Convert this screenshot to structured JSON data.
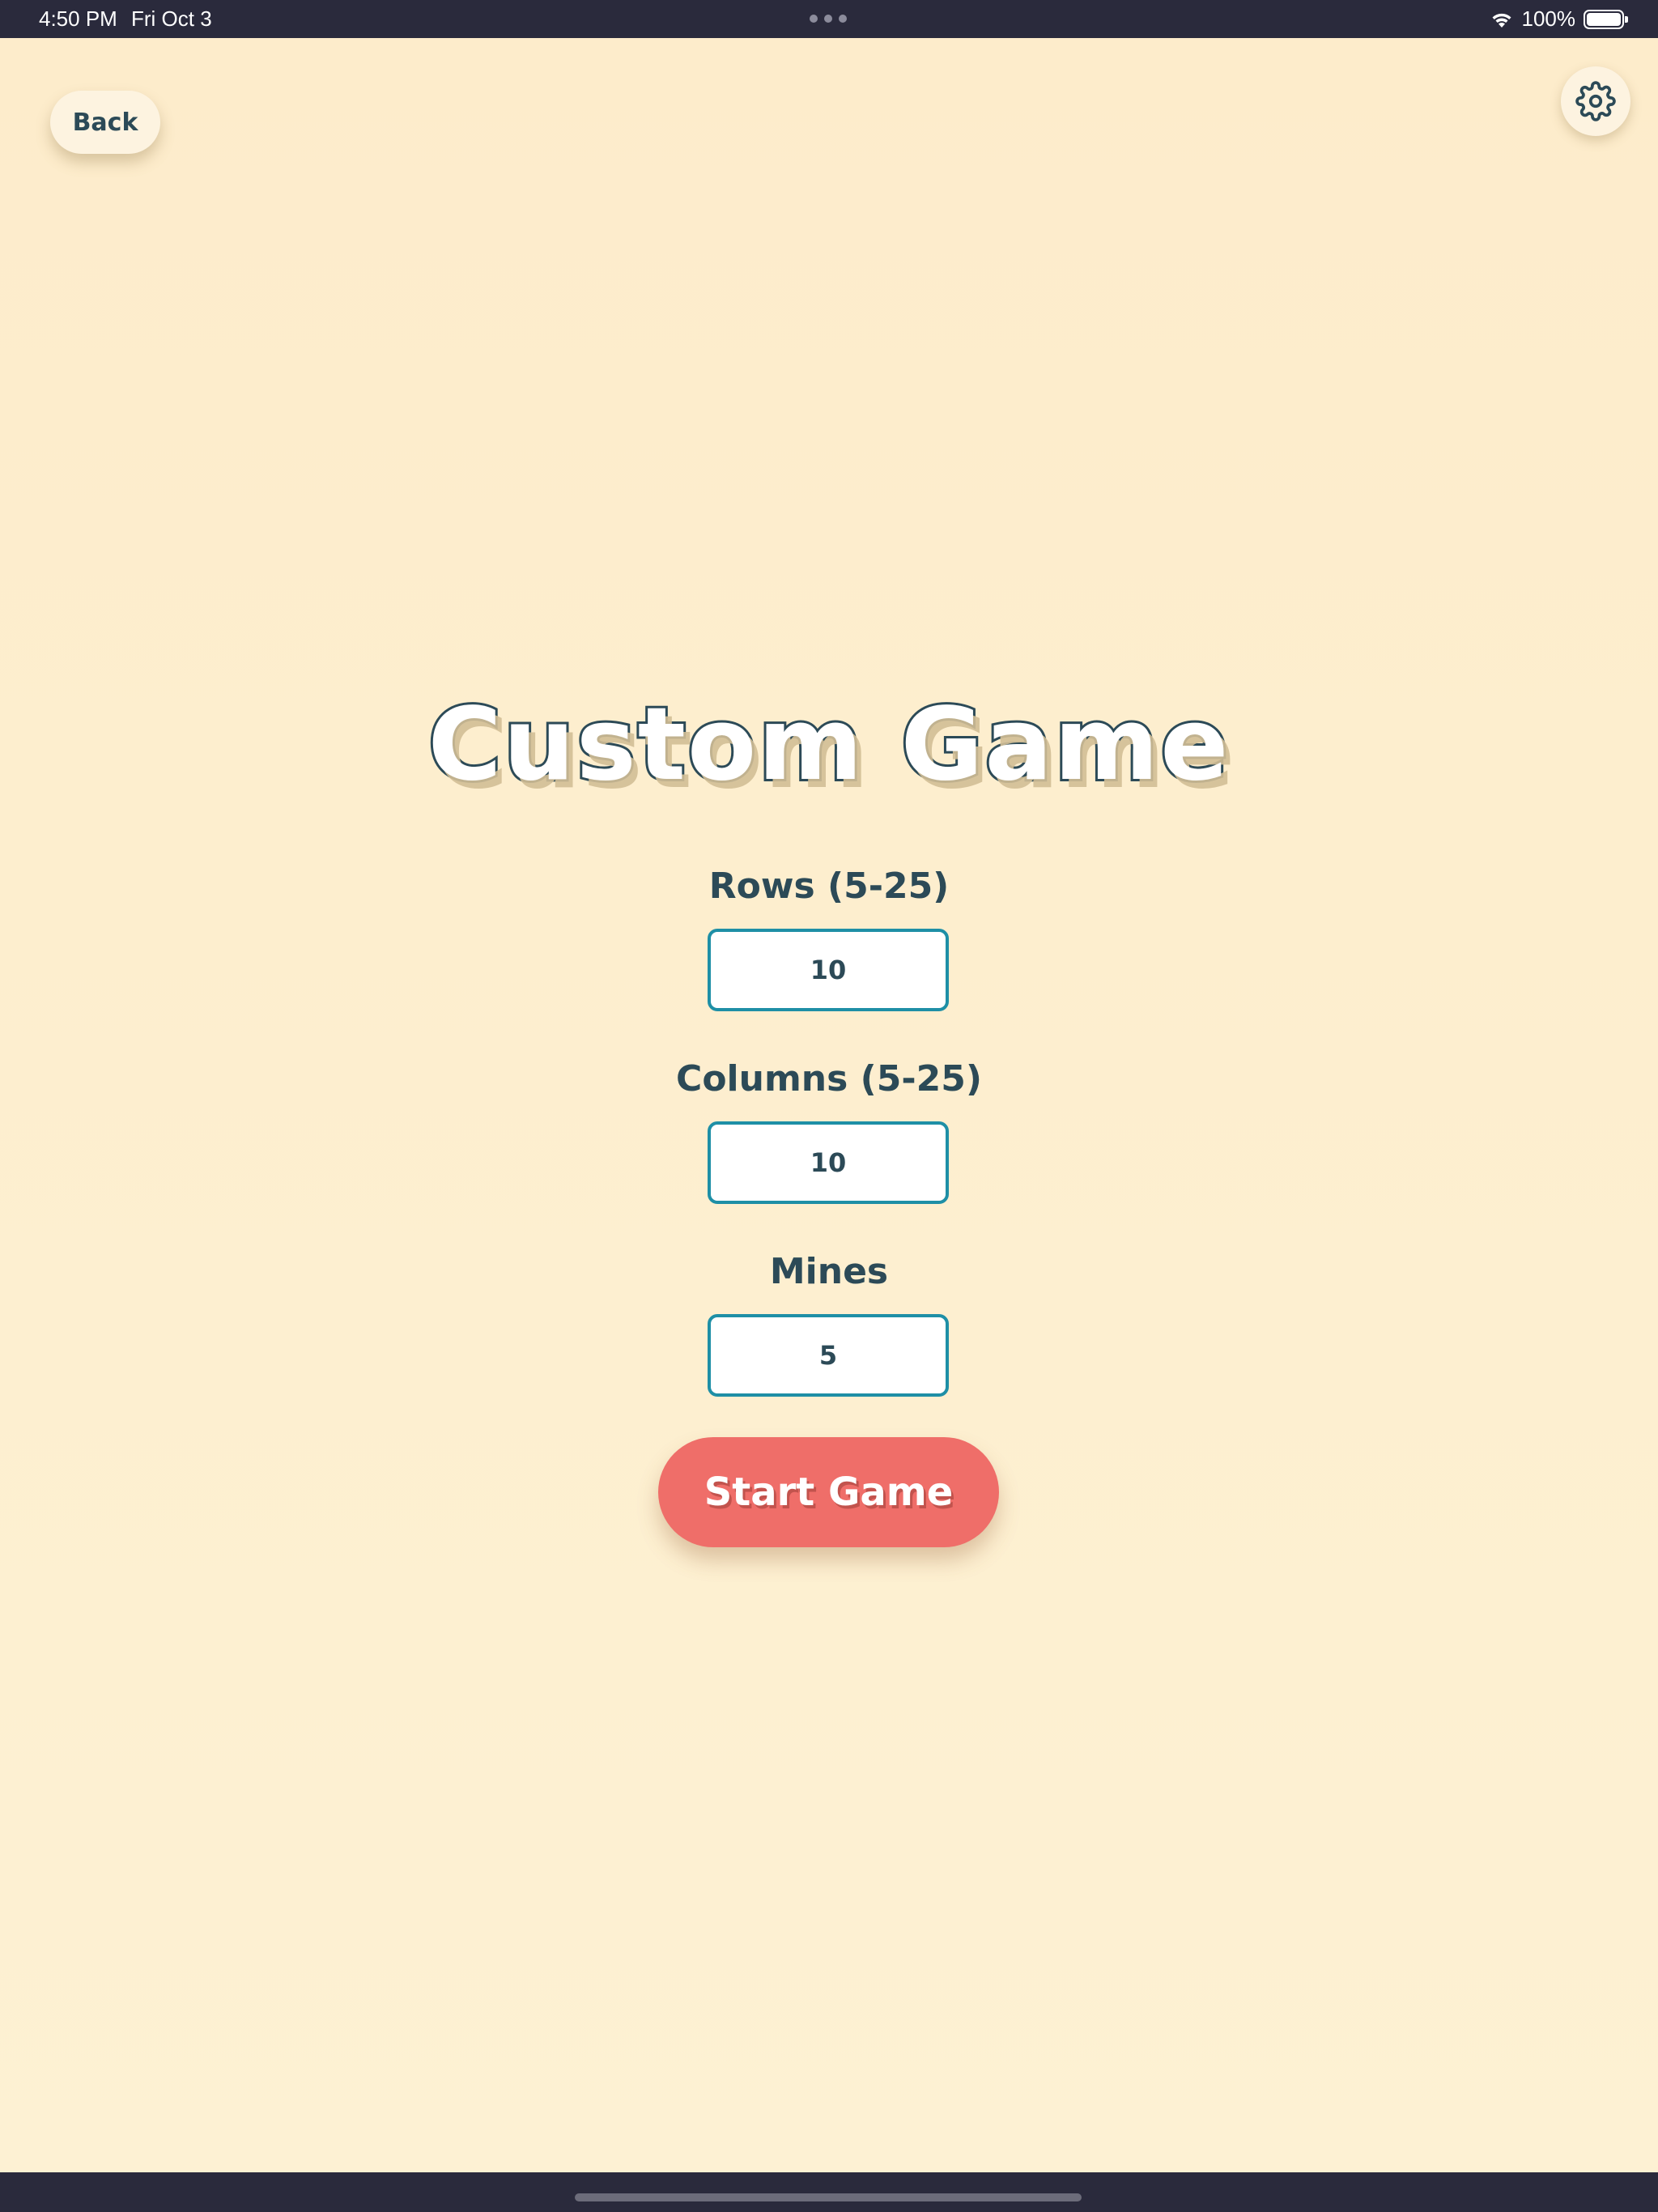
{
  "status_bar": {
    "time": "4:50 PM",
    "date": "Fri Oct 3",
    "battery": "100%",
    "wifi_icon": "wifi-icon",
    "battery_icon": "battery-icon"
  },
  "header": {
    "back_label": "Back",
    "settings_icon": "gear-icon"
  },
  "main": {
    "title": "Custom Game",
    "fields": [
      {
        "label": "Rows (5-25)",
        "value": "10"
      },
      {
        "label": "Columns (5-25)",
        "value": "10"
      },
      {
        "label": "Mines",
        "value": "5"
      }
    ],
    "start_label": "Start Game"
  },
  "colors": {
    "background": "#fdeecf",
    "text_dark": "#2c4a57",
    "input_border": "#1e8fa6",
    "start_button": "#ef6e69",
    "system_bar": "#2a2a3c"
  }
}
